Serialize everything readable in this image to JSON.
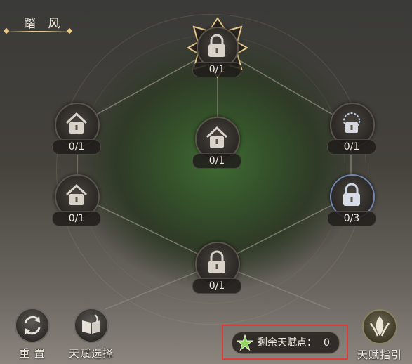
{
  "header": {
    "title": "踏 风"
  },
  "nodes": [
    {
      "id": "top",
      "count": "0/1",
      "selected": true
    },
    {
      "id": "left-1",
      "count": "0/1"
    },
    {
      "id": "center",
      "count": "0/1"
    },
    {
      "id": "right-1",
      "count": "0/1"
    },
    {
      "id": "left-2",
      "count": "0/1"
    },
    {
      "id": "right-2",
      "count": "0/3"
    },
    {
      "id": "bottom",
      "count": "0/1"
    }
  ],
  "bottom_bar": {
    "reset_label": "重 置",
    "talent_select_label": "天赋选择",
    "remaining_label": "剩余天赋点：",
    "remaining_value": "0",
    "guide_label": "天赋指引"
  },
  "colors": {
    "highlight_border": "#e23a3a",
    "gold_accent": "#e6c98c",
    "green_glow": "#3f6a33"
  },
  "icons": {
    "locked_node": "lock-icon",
    "reset": "refresh-icon",
    "talent_select": "book-icon",
    "guide": "guide-emblem-icon",
    "points": "talent-star-icon"
  }
}
